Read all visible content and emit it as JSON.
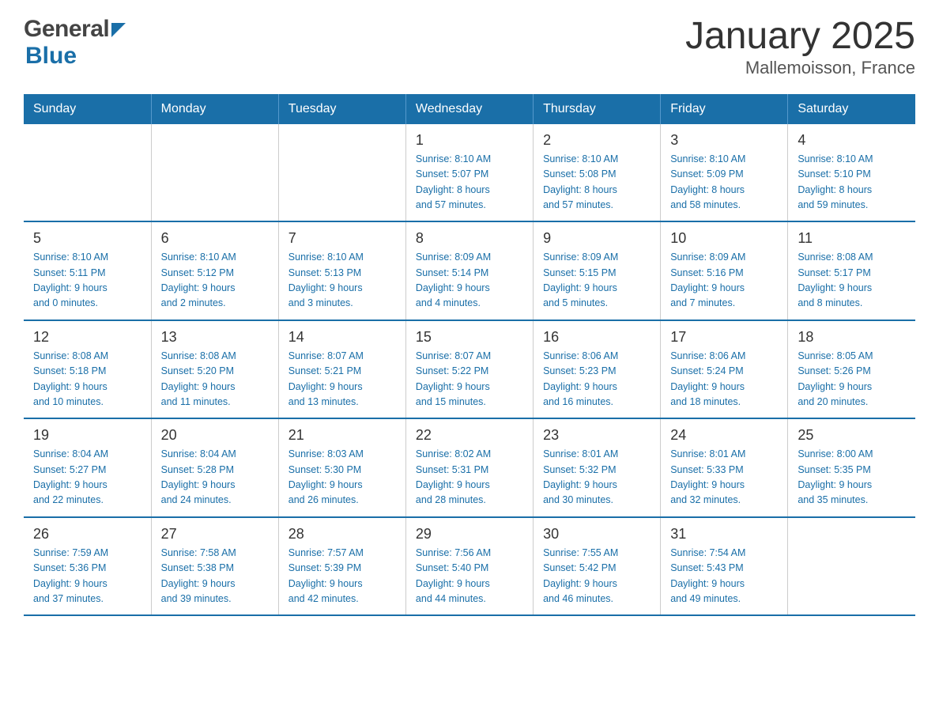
{
  "header": {
    "title": "January 2025",
    "subtitle": "Mallemoisson, France"
  },
  "logo": {
    "general": "General",
    "blue": "Blue"
  },
  "weekdays": [
    "Sunday",
    "Monday",
    "Tuesday",
    "Wednesday",
    "Thursday",
    "Friday",
    "Saturday"
  ],
  "weeks": [
    [
      {
        "day": "",
        "info": ""
      },
      {
        "day": "",
        "info": ""
      },
      {
        "day": "",
        "info": ""
      },
      {
        "day": "1",
        "info": "Sunrise: 8:10 AM\nSunset: 5:07 PM\nDaylight: 8 hours\nand 57 minutes."
      },
      {
        "day": "2",
        "info": "Sunrise: 8:10 AM\nSunset: 5:08 PM\nDaylight: 8 hours\nand 57 minutes."
      },
      {
        "day": "3",
        "info": "Sunrise: 8:10 AM\nSunset: 5:09 PM\nDaylight: 8 hours\nand 58 minutes."
      },
      {
        "day": "4",
        "info": "Sunrise: 8:10 AM\nSunset: 5:10 PM\nDaylight: 8 hours\nand 59 minutes."
      }
    ],
    [
      {
        "day": "5",
        "info": "Sunrise: 8:10 AM\nSunset: 5:11 PM\nDaylight: 9 hours\nand 0 minutes."
      },
      {
        "day": "6",
        "info": "Sunrise: 8:10 AM\nSunset: 5:12 PM\nDaylight: 9 hours\nand 2 minutes."
      },
      {
        "day": "7",
        "info": "Sunrise: 8:10 AM\nSunset: 5:13 PM\nDaylight: 9 hours\nand 3 minutes."
      },
      {
        "day": "8",
        "info": "Sunrise: 8:09 AM\nSunset: 5:14 PM\nDaylight: 9 hours\nand 4 minutes."
      },
      {
        "day": "9",
        "info": "Sunrise: 8:09 AM\nSunset: 5:15 PM\nDaylight: 9 hours\nand 5 minutes."
      },
      {
        "day": "10",
        "info": "Sunrise: 8:09 AM\nSunset: 5:16 PM\nDaylight: 9 hours\nand 7 minutes."
      },
      {
        "day": "11",
        "info": "Sunrise: 8:08 AM\nSunset: 5:17 PM\nDaylight: 9 hours\nand 8 minutes."
      }
    ],
    [
      {
        "day": "12",
        "info": "Sunrise: 8:08 AM\nSunset: 5:18 PM\nDaylight: 9 hours\nand 10 minutes."
      },
      {
        "day": "13",
        "info": "Sunrise: 8:08 AM\nSunset: 5:20 PM\nDaylight: 9 hours\nand 11 minutes."
      },
      {
        "day": "14",
        "info": "Sunrise: 8:07 AM\nSunset: 5:21 PM\nDaylight: 9 hours\nand 13 minutes."
      },
      {
        "day": "15",
        "info": "Sunrise: 8:07 AM\nSunset: 5:22 PM\nDaylight: 9 hours\nand 15 minutes."
      },
      {
        "day": "16",
        "info": "Sunrise: 8:06 AM\nSunset: 5:23 PM\nDaylight: 9 hours\nand 16 minutes."
      },
      {
        "day": "17",
        "info": "Sunrise: 8:06 AM\nSunset: 5:24 PM\nDaylight: 9 hours\nand 18 minutes."
      },
      {
        "day": "18",
        "info": "Sunrise: 8:05 AM\nSunset: 5:26 PM\nDaylight: 9 hours\nand 20 minutes."
      }
    ],
    [
      {
        "day": "19",
        "info": "Sunrise: 8:04 AM\nSunset: 5:27 PM\nDaylight: 9 hours\nand 22 minutes."
      },
      {
        "day": "20",
        "info": "Sunrise: 8:04 AM\nSunset: 5:28 PM\nDaylight: 9 hours\nand 24 minutes."
      },
      {
        "day": "21",
        "info": "Sunrise: 8:03 AM\nSunset: 5:30 PM\nDaylight: 9 hours\nand 26 minutes."
      },
      {
        "day": "22",
        "info": "Sunrise: 8:02 AM\nSunset: 5:31 PM\nDaylight: 9 hours\nand 28 minutes."
      },
      {
        "day": "23",
        "info": "Sunrise: 8:01 AM\nSunset: 5:32 PM\nDaylight: 9 hours\nand 30 minutes."
      },
      {
        "day": "24",
        "info": "Sunrise: 8:01 AM\nSunset: 5:33 PM\nDaylight: 9 hours\nand 32 minutes."
      },
      {
        "day": "25",
        "info": "Sunrise: 8:00 AM\nSunset: 5:35 PM\nDaylight: 9 hours\nand 35 minutes."
      }
    ],
    [
      {
        "day": "26",
        "info": "Sunrise: 7:59 AM\nSunset: 5:36 PM\nDaylight: 9 hours\nand 37 minutes."
      },
      {
        "day": "27",
        "info": "Sunrise: 7:58 AM\nSunset: 5:38 PM\nDaylight: 9 hours\nand 39 minutes."
      },
      {
        "day": "28",
        "info": "Sunrise: 7:57 AM\nSunset: 5:39 PM\nDaylight: 9 hours\nand 42 minutes."
      },
      {
        "day": "29",
        "info": "Sunrise: 7:56 AM\nSunset: 5:40 PM\nDaylight: 9 hours\nand 44 minutes."
      },
      {
        "day": "30",
        "info": "Sunrise: 7:55 AM\nSunset: 5:42 PM\nDaylight: 9 hours\nand 46 minutes."
      },
      {
        "day": "31",
        "info": "Sunrise: 7:54 AM\nSunset: 5:43 PM\nDaylight: 9 hours\nand 49 minutes."
      },
      {
        "day": "",
        "info": ""
      }
    ]
  ]
}
